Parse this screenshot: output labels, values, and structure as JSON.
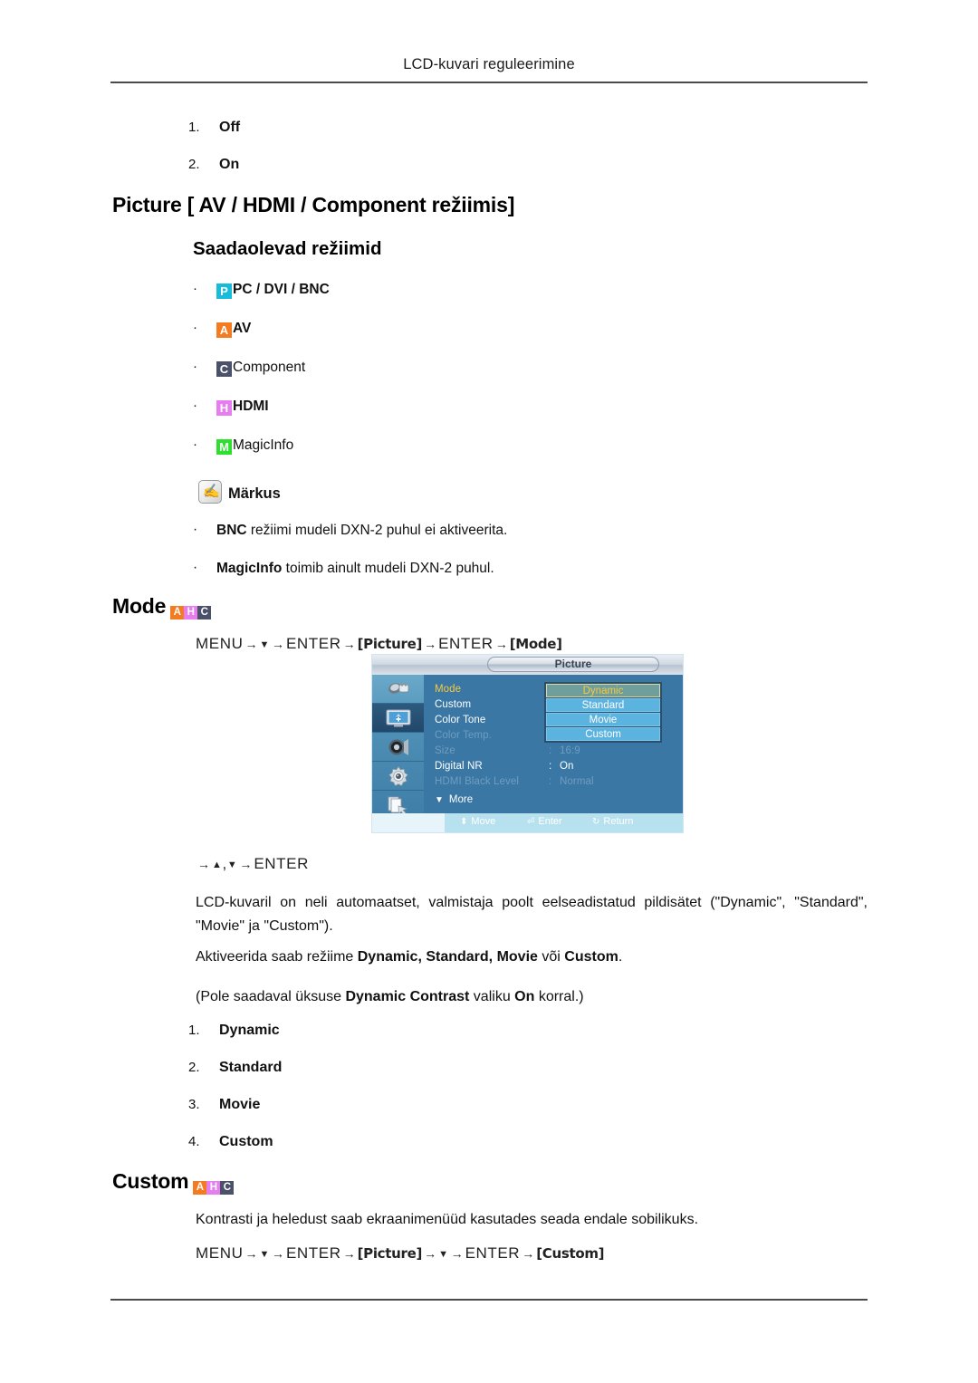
{
  "header": {
    "title": "LCD-kuvari reguleerimine"
  },
  "top_list": [
    {
      "num": "1.",
      "label": "Off"
    },
    {
      "num": "2.",
      "label": "On"
    }
  ],
  "section_picture": {
    "heading": "Picture [ AV / HDMI / Component režiimis]",
    "subheading": "Saadaolevad režiimid",
    "modes": [
      {
        "badge": "P",
        "badge_color": "#19bcd8",
        "label": "PC / DVI / BNC",
        "bold": true
      },
      {
        "badge": "A",
        "badge_color": "#f57b20",
        "label": "AV",
        "bold": true
      },
      {
        "badge": "C",
        "badge_color": "#4a5168",
        "label": "Component",
        "bold": false
      },
      {
        "badge": "H",
        "badge_color": "#e67ef0",
        "label": "HDMI",
        "bold": true
      },
      {
        "badge": "M",
        "badge_color": "#2ee02e",
        "label": "MagicInfo",
        "bold": false
      }
    ]
  },
  "note": {
    "title": "Märkus",
    "icon": "note-pen-icon",
    "items": [
      {
        "bold": "BNC",
        "rest": " režiimi mudeli DXN-2 puhul ei aktiveerita."
      },
      {
        "bold": "MagicInfo",
        "rest": " toimib ainult mudeli DXN-2 puhul."
      }
    ]
  },
  "section_mode": {
    "title": "Mode",
    "badges": [
      "A",
      "H",
      "C"
    ],
    "breadcrumb": {
      "menu": "MENU",
      "down": "▼",
      "enter": "ENTER",
      "key1": "[Picture]",
      "enter2": "ENTER",
      "key2": "[Mode]",
      "arrow": "→"
    },
    "breadcrumb2": {
      "prefix": "→",
      "up": "▲",
      "comma": ",",
      "down": "▼",
      "arrow": "→",
      "enter": "ENTER"
    },
    "paragraph1": "LCD-kuvaril on neli automaatset, valmistaja poolt eelseadistatud pildisätet (\"Dynamic\", \"Standard\", \"Movie\" ja \"Custom\").",
    "paragraph2_pre": "Aktiveerida saab režiime  ",
    "paragraph2_items": "Dynamic, Standard, Movie",
    "paragraph2_mid": " või ",
    "paragraph2_last": "Custom",
    "paragraph2_end": ".",
    "paragraph3_pre": "(Pole saadaval üksuse ",
    "paragraph3_bold": "Dynamic Contrast",
    "paragraph3_mid": " valiku ",
    "paragraph3_bold2": "On",
    "paragraph3_end": " korral.)",
    "list": [
      {
        "num": "1.",
        "label": "Dynamic"
      },
      {
        "num": "2.",
        "label": "Standard"
      },
      {
        "num": "3.",
        "label": "Movie"
      },
      {
        "num": "4.",
        "label": "Custom"
      }
    ]
  },
  "section_custom": {
    "title": "Custom",
    "badges": [
      "A",
      "H",
      "C"
    ],
    "paragraph": "Kontrasti ja heledust saab ekraanimenüüd kasutades seada endale sobilikuks.",
    "breadcrumb": {
      "menu": "MENU",
      "down": "▼",
      "enter": "ENTER",
      "key1": "[Picture]",
      "down2": "▼",
      "enter2": "ENTER",
      "key2": "[Custom]",
      "arrow": "→"
    }
  },
  "osd": {
    "title": "Picture",
    "sidebar_icons": [
      "input-source-icon",
      "picture-monitor-icon",
      "sound-speaker-icon",
      "setup-gear-icon",
      "multi-control-icon"
    ],
    "rows": [
      {
        "label": "Mode",
        "colon": ":",
        "value": "",
        "state": "selected"
      },
      {
        "label": "Custom",
        "colon": "",
        "value": "",
        "state": "normal"
      },
      {
        "label": "Color Tone",
        "colon": ":",
        "value": "",
        "state": "normal"
      },
      {
        "label": "Color Temp.",
        "colon": "",
        "value": "",
        "state": "dim"
      },
      {
        "label": "Size",
        "colon": ":",
        "value": "16:9",
        "state": "dim"
      },
      {
        "label": "Digital NR",
        "colon": ":",
        "value": "On",
        "state": "normal"
      },
      {
        "label": "HDMI Black Level",
        "colon": ":",
        "value": "Normal",
        "state": "dim"
      }
    ],
    "more_label": "More",
    "more_caret": "▼",
    "dropdown": [
      {
        "label": "Dynamic",
        "active": true
      },
      {
        "label": "Standard",
        "active": false
      },
      {
        "label": "Movie",
        "active": false
      },
      {
        "label": "Custom",
        "active": false
      }
    ],
    "hints": [
      {
        "glyph": "⬍",
        "label": "Move"
      },
      {
        "glyph": "⏎",
        "label": "Enter"
      },
      {
        "glyph": "↻",
        "label": "Return"
      }
    ],
    "colors": {
      "panel_bg": "#3a77a5",
      "selected_text": "#f4c842",
      "dim_text": "#6f9dc0",
      "option_bg": "#5bb3e0",
      "option_active_bg": "#6f9e9b",
      "bottom_bar": "#b8e1f0"
    }
  }
}
